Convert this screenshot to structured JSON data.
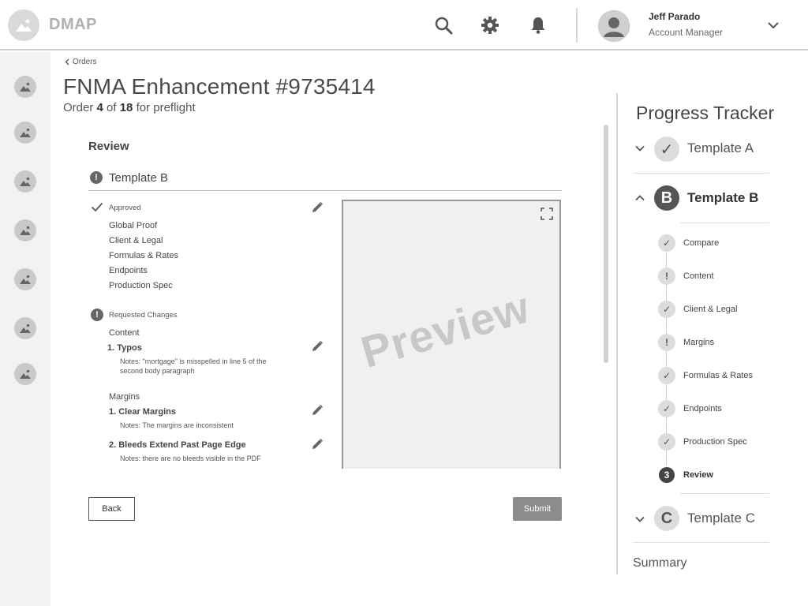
{
  "header": {
    "brand": "DMAP",
    "user": {
      "name": "Jeff Parado",
      "role": "Account Manager"
    }
  },
  "breadcrumb": {
    "label": "Orders"
  },
  "page": {
    "title": "FNMA Enhancement #9735414",
    "subtitle": {
      "prefix": "Order ",
      "current": "4",
      "middle": " of ",
      "total": "18",
      "suffix": " for preflight"
    }
  },
  "review": {
    "title": "Review",
    "template": "Template B",
    "approved": {
      "label": "Approved",
      "items": [
        "Global Proof",
        "Client & Legal",
        "Formulas & Rates",
        "Endpoints",
        "Production Spec"
      ]
    },
    "requested": {
      "label": "Requested Changes",
      "groups": [
        {
          "name": "Content",
          "issues": [
            {
              "title": "1. Typos",
              "note": "Notes: \"mortgage\" is misspelled in line 5 of the second body paragraph"
            }
          ]
        },
        {
          "name": "Margins",
          "issues": [
            {
              "title": "1. Clear Margins",
              "note": "Notes: The margins are inconsistent"
            },
            {
              "title": "2. Bleeds Extend Past Page Edge",
              "note": "Notes: there are no bleeds visible in the PDF"
            }
          ]
        }
      ]
    },
    "preview_text": "Preview",
    "back_label": "Back",
    "submit_label": "Submit"
  },
  "progress": {
    "title": "Progress Tracker",
    "templates": [
      {
        "badge": "✓",
        "label": "Template A"
      },
      {
        "badge": "B",
        "label": "Template B"
      },
      {
        "badge": "C",
        "label": "Template C"
      }
    ],
    "steps": [
      {
        "badge": "✓",
        "label": "Compare"
      },
      {
        "badge": "!",
        "label": "Content"
      },
      {
        "badge": "✓",
        "label": "Client & Legal"
      },
      {
        "badge": "!",
        "label": "Margins"
      },
      {
        "badge": "✓",
        "label": "Formulas & Rates"
      },
      {
        "badge": "✓",
        "label": "Endpoints"
      },
      {
        "badge": "✓",
        "label": "Production Spec"
      },
      {
        "badge": "3",
        "label": "Review"
      }
    ],
    "summary": "Summary"
  },
  "colors": {
    "accent": "#555555",
    "muted": "#dcdcdc",
    "submit": "#8c8c8c"
  }
}
